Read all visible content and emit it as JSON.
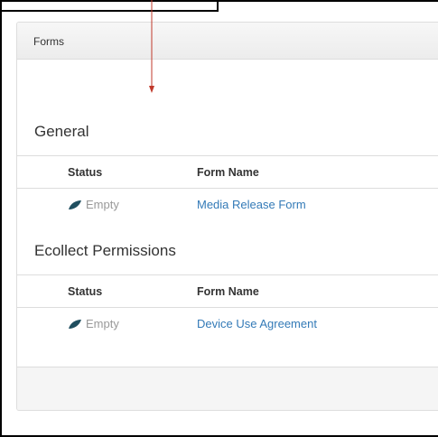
{
  "panel": {
    "heading": "Forms",
    "footer": ""
  },
  "sections": [
    {
      "title": "General",
      "columns": {
        "status": "Status",
        "form_name": "Form Name"
      },
      "rows": [
        {
          "status": "Empty",
          "status_icon": "leaf-icon",
          "form_name": "Media Release Form"
        }
      ]
    },
    {
      "title": "Ecollect Permissions",
      "columns": {
        "status": "Status",
        "form_name": "Form Name"
      },
      "rows": [
        {
          "status": "Empty",
          "status_icon": "leaf-icon",
          "form_name": "Device Use Agreement"
        }
      ]
    }
  ],
  "colors": {
    "link": "#337ab7",
    "status_empty": "#999999",
    "leaf_icon": "#1f4e5f",
    "annotation_arrow": "#c0392b"
  }
}
